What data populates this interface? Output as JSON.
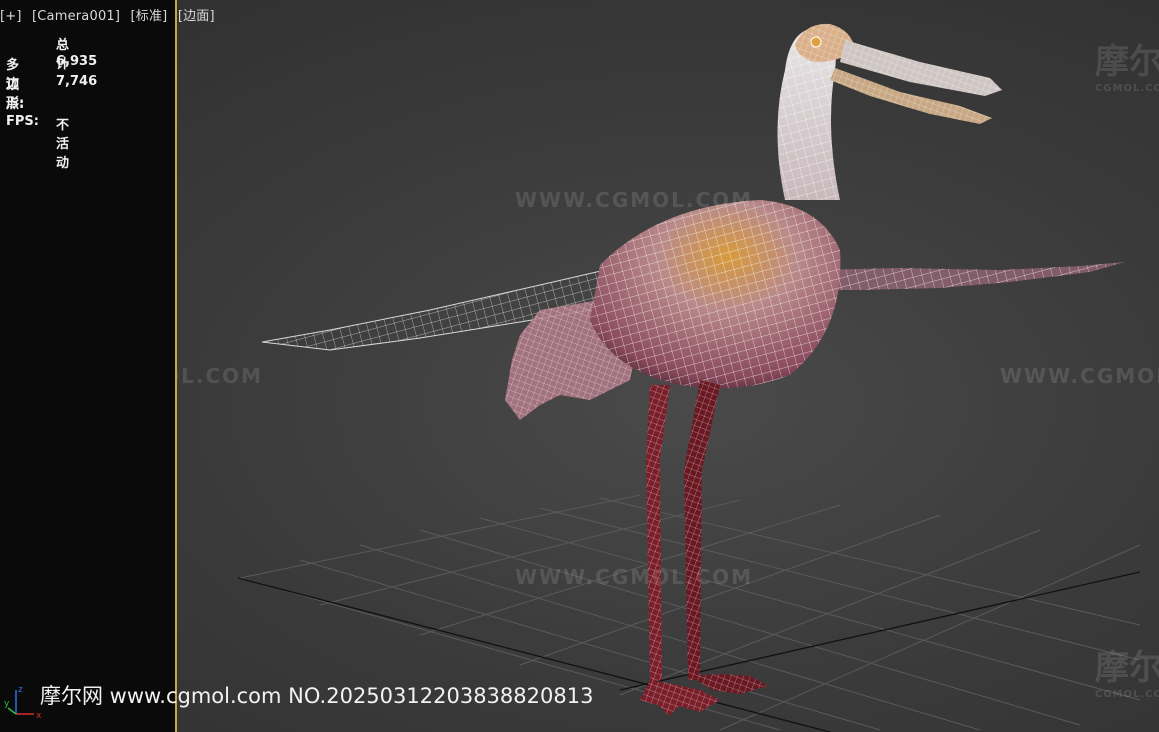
{
  "viewport": {
    "labels": [
      "[+]",
      "[Camera001]",
      "[标准]",
      "[边面]"
    ]
  },
  "stats": {
    "header": "总计",
    "rows": [
      {
        "label": "多边形:",
        "value": "6,935"
      },
      {
        "label": "顶点:",
        "value": "7,746"
      }
    ],
    "fps_label": "FPS:",
    "fps_value": "不活动"
  },
  "watermarks": {
    "url": "WWW.CGMOL.COM",
    "cn": "摩尔网",
    "cn_sub": "CGMOL.COM"
  },
  "footer": {
    "text": "摩尔网 www.cgmol.com NO.20250312203838820813"
  },
  "axis": {
    "x": "x",
    "y": "y",
    "z": "z"
  },
  "colors": {
    "panel_border": "#c8a64a",
    "wire": "#ffffff",
    "body_pink": "#b97a8e",
    "leg_red": "#7a1f2a",
    "accent_orange": "#d89a3c"
  }
}
